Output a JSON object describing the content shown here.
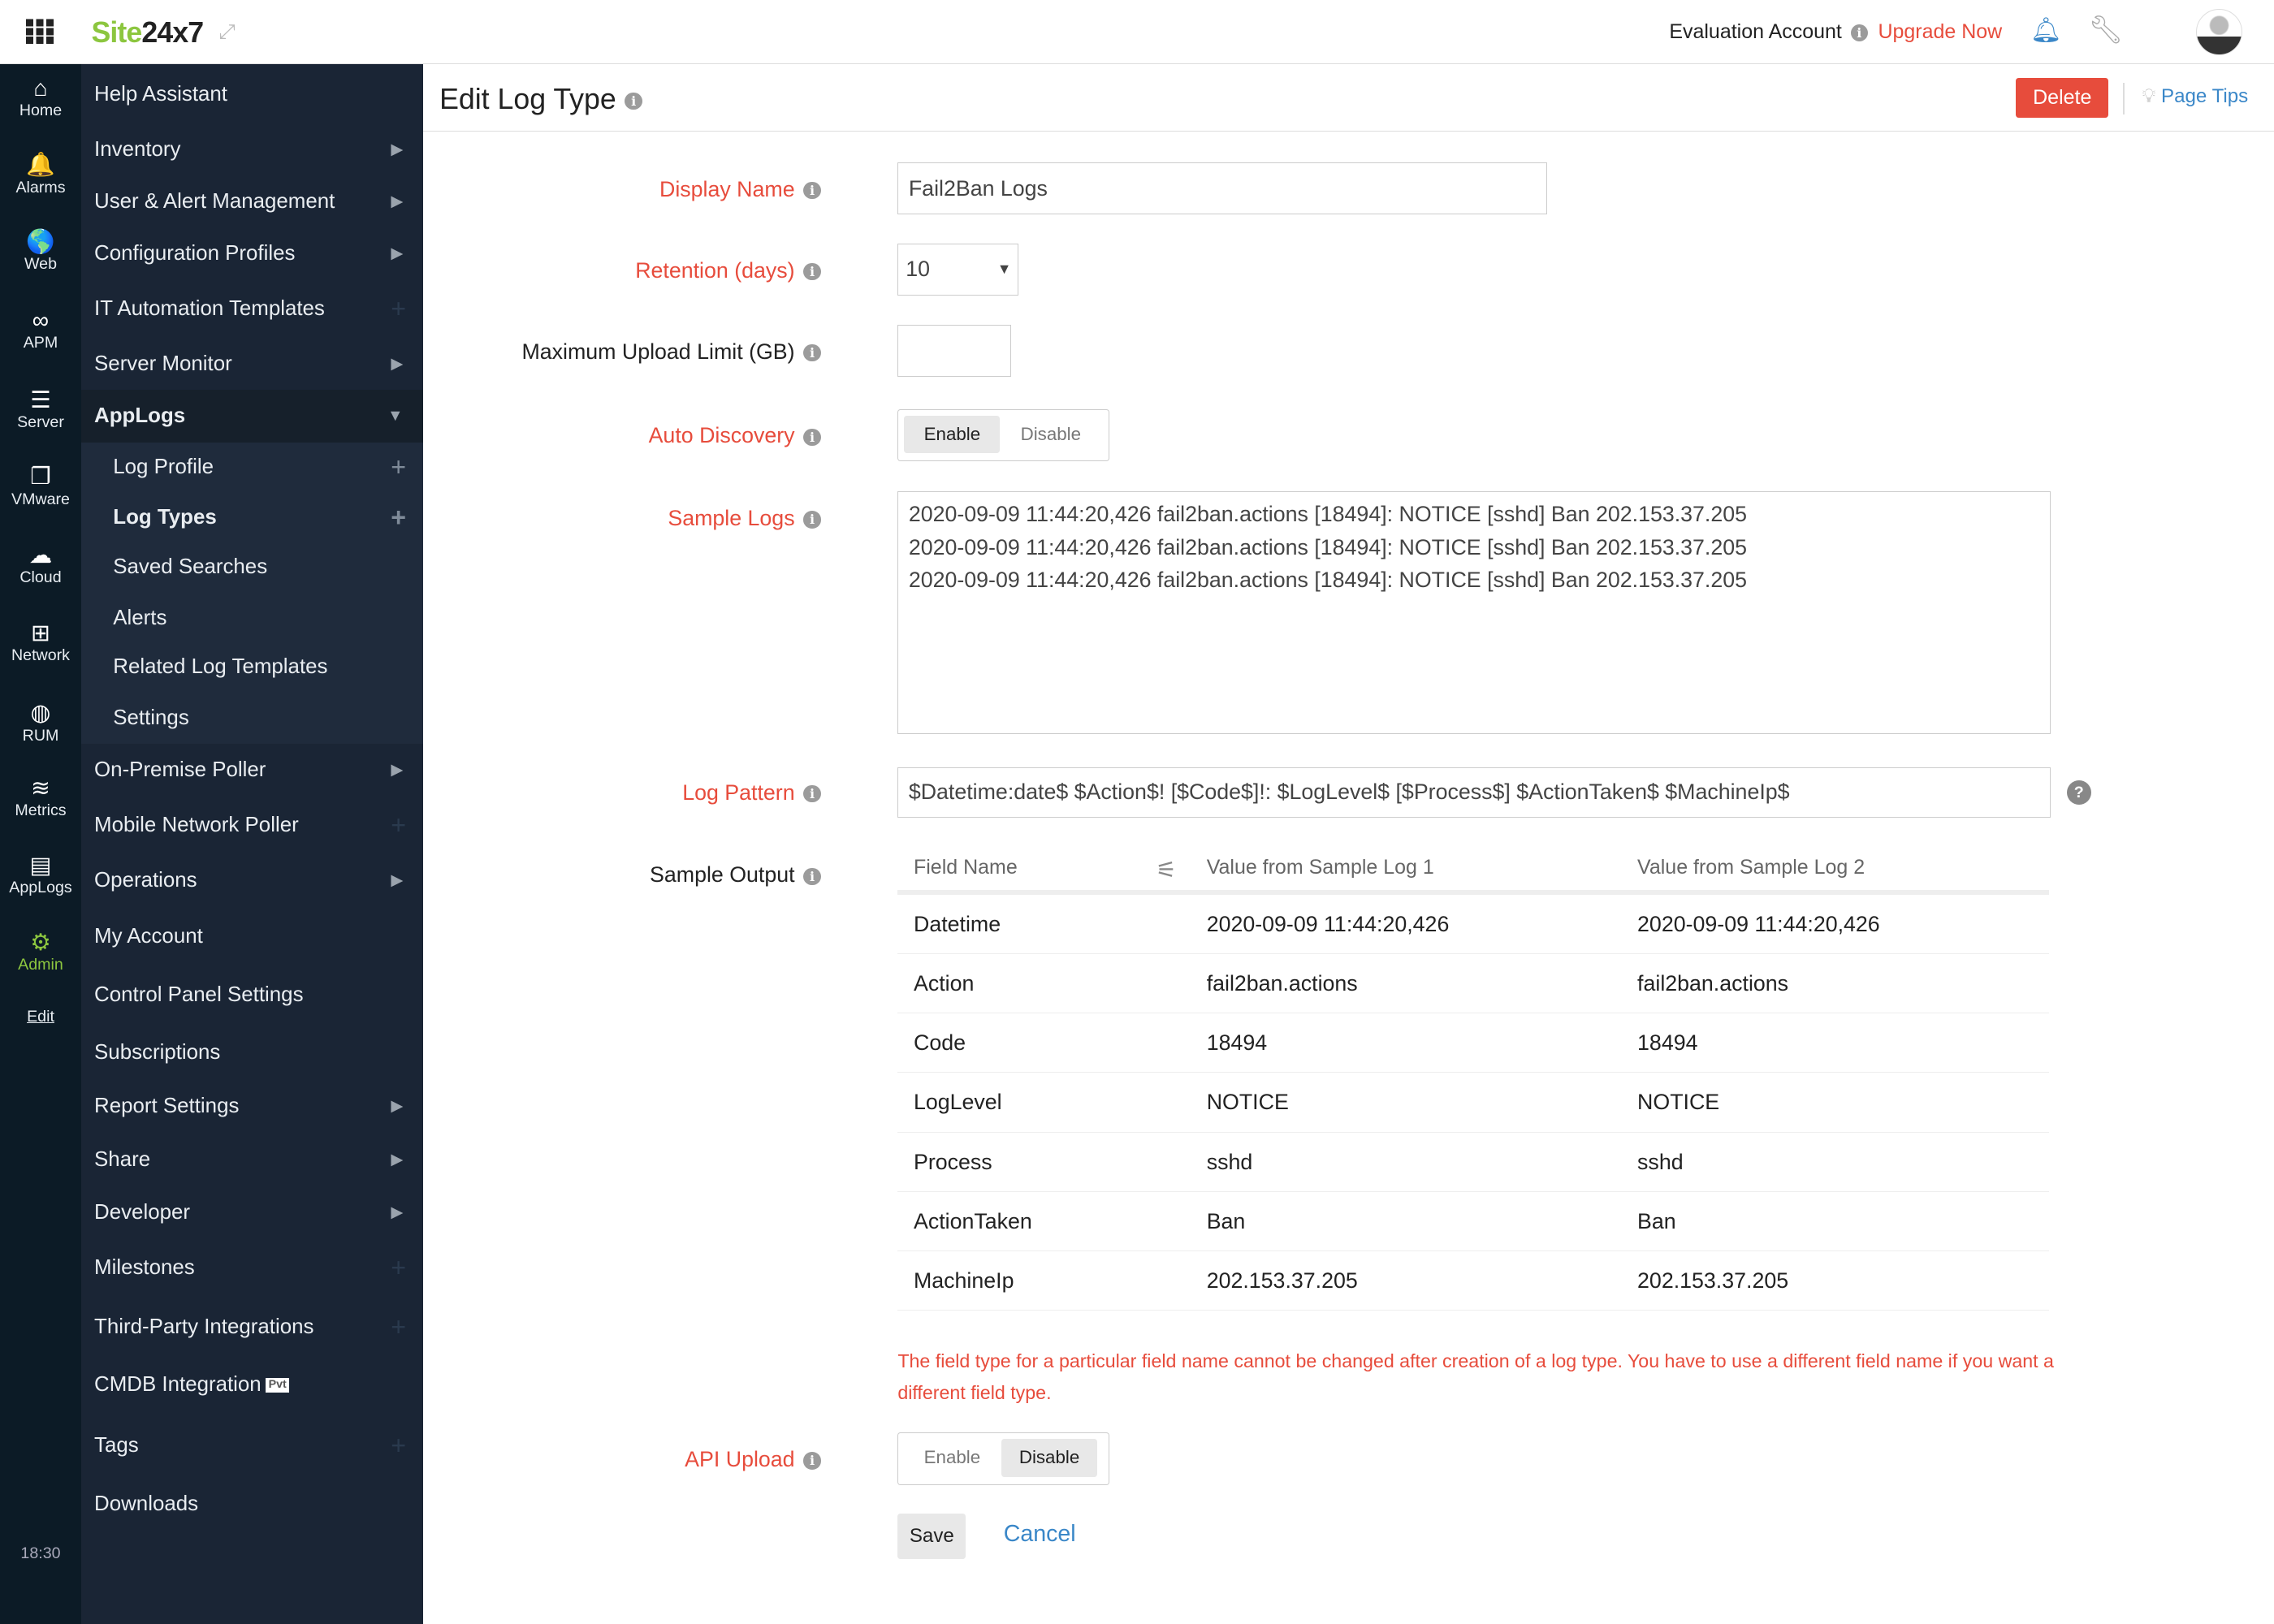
{
  "topbar": {
    "brand_green": "Site",
    "brand_dark": "24x7",
    "account": "Evaluation Account",
    "upgrade": "Upgrade Now",
    "icons": [
      "apps-grid-icon",
      "expand-icon",
      "info-icon",
      "bell-icon",
      "wrench-icon",
      "avatar"
    ]
  },
  "rail": [
    {
      "label": "Home",
      "icon": "home-icon",
      "glyph": "⌂"
    },
    {
      "label": "Alarms",
      "icon": "bell-icon",
      "glyph": "🔔"
    },
    {
      "label": "Web",
      "icon": "globe-icon",
      "glyph": "🌎"
    },
    {
      "label": "APM",
      "icon": "binoculars-icon",
      "glyph": "∞"
    },
    {
      "label": "Server",
      "icon": "server-icon",
      "glyph": "☰"
    },
    {
      "label": "VMware",
      "icon": "vmware-icon",
      "glyph": "❐"
    },
    {
      "label": "Cloud",
      "icon": "cloud-icon",
      "glyph": "☁"
    },
    {
      "label": "Network",
      "icon": "network-icon",
      "glyph": "⊞"
    },
    {
      "label": "RUM",
      "icon": "rum-globe-icon",
      "glyph": "◍"
    },
    {
      "label": "Metrics",
      "icon": "metrics-icon",
      "glyph": "≋"
    },
    {
      "label": "AppLogs",
      "icon": "applogs-icon",
      "glyph": "▤"
    },
    {
      "label": "Admin",
      "icon": "gear-icon",
      "glyph": "⚙"
    }
  ],
  "rail_edit": "Edit",
  "rail_time": "18:30",
  "menu": [
    {
      "label": "Help Assistant",
      "mark": ""
    },
    {
      "label": "Inventory",
      "mark": "arrow"
    },
    {
      "label": "User & Alert Management",
      "mark": "arrow"
    },
    {
      "label": "Configuration Profiles",
      "mark": "arrow"
    },
    {
      "label": "IT Automation Templates",
      "mark": "plus"
    },
    {
      "label": "Server Monitor",
      "mark": "arrow"
    },
    {
      "label": "AppLogs",
      "mark": "down",
      "active": true
    },
    {
      "label": "Log Profile",
      "mark": "plus",
      "sub": true
    },
    {
      "label": "Log Types",
      "mark": "plus",
      "sub": true,
      "selected": true
    },
    {
      "label": "Saved Searches",
      "mark": "",
      "sub": true
    },
    {
      "label": "Alerts",
      "mark": "",
      "sub": true
    },
    {
      "label": "Related Log Templates",
      "mark": "",
      "sub": true
    },
    {
      "label": "Settings",
      "mark": "",
      "sub": true
    },
    {
      "label": "On-Premise Poller",
      "mark": "arrow"
    },
    {
      "label": "Mobile Network Poller",
      "mark": "plus"
    },
    {
      "label": "Operations",
      "mark": "arrow"
    },
    {
      "label": "My Account",
      "mark": ""
    },
    {
      "label": "Control Panel Settings",
      "mark": ""
    },
    {
      "label": "Subscriptions",
      "mark": ""
    },
    {
      "label": "Report Settings",
      "mark": "arrow"
    },
    {
      "label": "Share",
      "mark": "arrow"
    },
    {
      "label": "Developer",
      "mark": "arrow"
    },
    {
      "label": "Milestones",
      "mark": "plus"
    },
    {
      "label": "Third-Party Integrations",
      "mark": "plus"
    },
    {
      "label": "CMDB Integration",
      "mark": "",
      "badge": "Pvt"
    },
    {
      "label": "Tags",
      "mark": "plus"
    },
    {
      "label": "Downloads",
      "mark": ""
    }
  ],
  "page": {
    "title": "Edit Log Type",
    "delete": "Delete",
    "page_tips": "Page Tips"
  },
  "form": {
    "display_name": {
      "label": "Display Name",
      "value": "Fail2Ban Logs"
    },
    "retention": {
      "label": "Retention (days)",
      "value": "10"
    },
    "max_upload": {
      "label": "Maximum Upload Limit (GB)",
      "value": ""
    },
    "auto_discovery": {
      "label": "Auto Discovery",
      "enable": "Enable",
      "disable": "Disable",
      "selected": "Enable"
    },
    "sample_logs": {
      "label": "Sample Logs",
      "lines": [
        "2020-09-09 11:44:20,426 fail2ban.actions [18494]: NOTICE [sshd] Ban 202.153.37.205",
        "2020-09-09 11:44:20,426 fail2ban.actions [18494]: NOTICE [sshd] Ban 202.153.37.205",
        "2020-09-09 11:44:20,426 fail2ban.actions [18494]: NOTICE [sshd] Ban 202.153.37.205"
      ]
    },
    "log_pattern": {
      "label": "Log Pattern",
      "value": "$Datetime:date$ $Action$! [$Code$]!: $LogLevel$ [$Process$] $ActionTaken$ $MachineIp$"
    },
    "sample_output": {
      "label": "Sample Output",
      "headers": [
        "Field Name",
        "Value from Sample Log 1",
        "Value from Sample Log 2"
      ],
      "rows": [
        [
          "Datetime",
          "2020-09-09 11:44:20,426",
          "2020-09-09 11:44:20,426"
        ],
        [
          "Action",
          "fail2ban.actions",
          "fail2ban.actions"
        ],
        [
          "Code",
          "18494",
          "18494"
        ],
        [
          "LogLevel",
          "NOTICE",
          "NOTICE"
        ],
        [
          "Process",
          "sshd",
          "sshd"
        ],
        [
          "ActionTaken",
          "Ban",
          "Ban"
        ],
        [
          "MachineIp",
          "202.153.37.205",
          "202.153.37.205"
        ]
      ]
    },
    "notice": "The field type for a particular field name cannot be changed after creation of a log type. You have to use a different field name if you want a different field type.",
    "api_upload": {
      "label": "API Upload",
      "enable": "Enable",
      "disable": "Disable",
      "selected": "Disable"
    },
    "save": "Save",
    "cancel": "Cancel"
  },
  "colors": {
    "brand_green": "#8cc63f",
    "red": "#e74c3c",
    "link": "#3a87c8",
    "rail": "#0c1b26",
    "menu": "#1a2535"
  }
}
